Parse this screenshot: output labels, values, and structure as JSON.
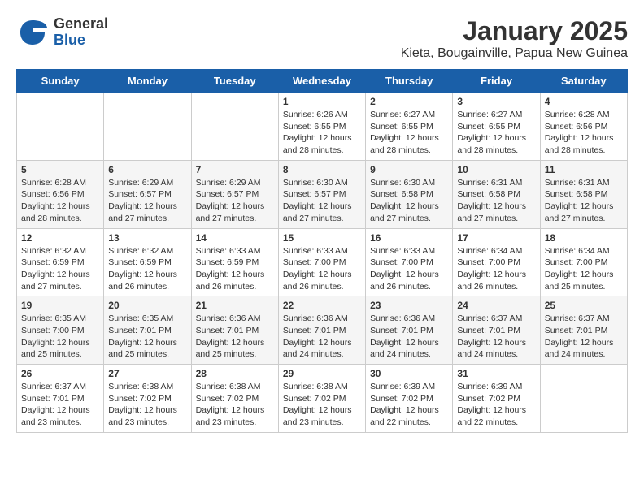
{
  "logo": {
    "general": "General",
    "blue": "Blue"
  },
  "header": {
    "title": "January 2025",
    "subtitle": "Kieta, Bougainville, Papua New Guinea"
  },
  "weekdays": [
    "Sunday",
    "Monday",
    "Tuesday",
    "Wednesday",
    "Thursday",
    "Friday",
    "Saturday"
  ],
  "weeks": [
    [
      {
        "day": "",
        "info": ""
      },
      {
        "day": "",
        "info": ""
      },
      {
        "day": "",
        "info": ""
      },
      {
        "day": "1",
        "info": "Sunrise: 6:26 AM\nSunset: 6:55 PM\nDaylight: 12 hours\nand 28 minutes."
      },
      {
        "day": "2",
        "info": "Sunrise: 6:27 AM\nSunset: 6:55 PM\nDaylight: 12 hours\nand 28 minutes."
      },
      {
        "day": "3",
        "info": "Sunrise: 6:27 AM\nSunset: 6:55 PM\nDaylight: 12 hours\nand 28 minutes."
      },
      {
        "day": "4",
        "info": "Sunrise: 6:28 AM\nSunset: 6:56 PM\nDaylight: 12 hours\nand 28 minutes."
      }
    ],
    [
      {
        "day": "5",
        "info": "Sunrise: 6:28 AM\nSunset: 6:56 PM\nDaylight: 12 hours\nand 28 minutes."
      },
      {
        "day": "6",
        "info": "Sunrise: 6:29 AM\nSunset: 6:57 PM\nDaylight: 12 hours\nand 27 minutes."
      },
      {
        "day": "7",
        "info": "Sunrise: 6:29 AM\nSunset: 6:57 PM\nDaylight: 12 hours\nand 27 minutes."
      },
      {
        "day": "8",
        "info": "Sunrise: 6:30 AM\nSunset: 6:57 PM\nDaylight: 12 hours\nand 27 minutes."
      },
      {
        "day": "9",
        "info": "Sunrise: 6:30 AM\nSunset: 6:58 PM\nDaylight: 12 hours\nand 27 minutes."
      },
      {
        "day": "10",
        "info": "Sunrise: 6:31 AM\nSunset: 6:58 PM\nDaylight: 12 hours\nand 27 minutes."
      },
      {
        "day": "11",
        "info": "Sunrise: 6:31 AM\nSunset: 6:58 PM\nDaylight: 12 hours\nand 27 minutes."
      }
    ],
    [
      {
        "day": "12",
        "info": "Sunrise: 6:32 AM\nSunset: 6:59 PM\nDaylight: 12 hours\nand 27 minutes."
      },
      {
        "day": "13",
        "info": "Sunrise: 6:32 AM\nSunset: 6:59 PM\nDaylight: 12 hours\nand 26 minutes."
      },
      {
        "day": "14",
        "info": "Sunrise: 6:33 AM\nSunset: 6:59 PM\nDaylight: 12 hours\nand 26 minutes."
      },
      {
        "day": "15",
        "info": "Sunrise: 6:33 AM\nSunset: 7:00 PM\nDaylight: 12 hours\nand 26 minutes."
      },
      {
        "day": "16",
        "info": "Sunrise: 6:33 AM\nSunset: 7:00 PM\nDaylight: 12 hours\nand 26 minutes."
      },
      {
        "day": "17",
        "info": "Sunrise: 6:34 AM\nSunset: 7:00 PM\nDaylight: 12 hours\nand 26 minutes."
      },
      {
        "day": "18",
        "info": "Sunrise: 6:34 AM\nSunset: 7:00 PM\nDaylight: 12 hours\nand 25 minutes."
      }
    ],
    [
      {
        "day": "19",
        "info": "Sunrise: 6:35 AM\nSunset: 7:00 PM\nDaylight: 12 hours\nand 25 minutes."
      },
      {
        "day": "20",
        "info": "Sunrise: 6:35 AM\nSunset: 7:01 PM\nDaylight: 12 hours\nand 25 minutes."
      },
      {
        "day": "21",
        "info": "Sunrise: 6:36 AM\nSunset: 7:01 PM\nDaylight: 12 hours\nand 25 minutes."
      },
      {
        "day": "22",
        "info": "Sunrise: 6:36 AM\nSunset: 7:01 PM\nDaylight: 12 hours\nand 24 minutes."
      },
      {
        "day": "23",
        "info": "Sunrise: 6:36 AM\nSunset: 7:01 PM\nDaylight: 12 hours\nand 24 minutes."
      },
      {
        "day": "24",
        "info": "Sunrise: 6:37 AM\nSunset: 7:01 PM\nDaylight: 12 hours\nand 24 minutes."
      },
      {
        "day": "25",
        "info": "Sunrise: 6:37 AM\nSunset: 7:01 PM\nDaylight: 12 hours\nand 24 minutes."
      }
    ],
    [
      {
        "day": "26",
        "info": "Sunrise: 6:37 AM\nSunset: 7:01 PM\nDaylight: 12 hours\nand 23 minutes."
      },
      {
        "day": "27",
        "info": "Sunrise: 6:38 AM\nSunset: 7:02 PM\nDaylight: 12 hours\nand 23 minutes."
      },
      {
        "day": "28",
        "info": "Sunrise: 6:38 AM\nSunset: 7:02 PM\nDaylight: 12 hours\nand 23 minutes."
      },
      {
        "day": "29",
        "info": "Sunrise: 6:38 AM\nSunset: 7:02 PM\nDaylight: 12 hours\nand 23 minutes."
      },
      {
        "day": "30",
        "info": "Sunrise: 6:39 AM\nSunset: 7:02 PM\nDaylight: 12 hours\nand 22 minutes."
      },
      {
        "day": "31",
        "info": "Sunrise: 6:39 AM\nSunset: 7:02 PM\nDaylight: 12 hours\nand 22 minutes."
      },
      {
        "day": "",
        "info": ""
      }
    ]
  ]
}
